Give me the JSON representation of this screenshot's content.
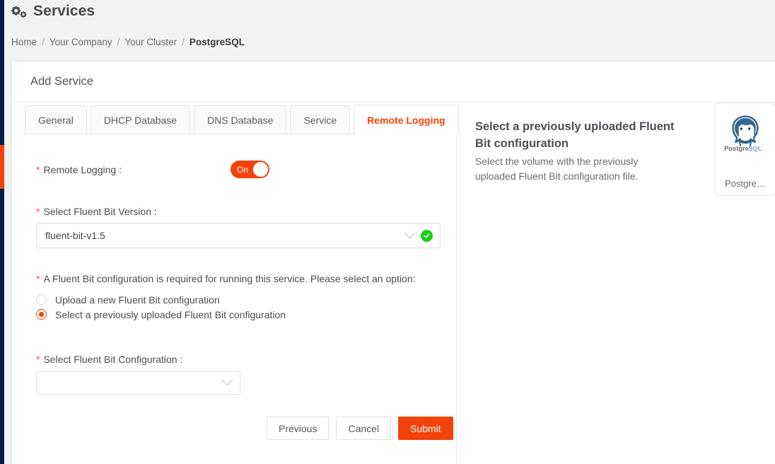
{
  "header": {
    "icon": "cogs-icon",
    "title": "Services",
    "breadcrumb": [
      {
        "label": "Home",
        "current": false
      },
      {
        "label": "Your Company",
        "current": false
      },
      {
        "label": "Your Cluster",
        "current": false
      },
      {
        "label": "PostgreSQL",
        "current": true
      }
    ],
    "separator": "/"
  },
  "card": {
    "title": "Add Service"
  },
  "tabs": [
    {
      "label": "General",
      "active": false
    },
    {
      "label": "DHCP Database",
      "active": false
    },
    {
      "label": "DNS Database",
      "active": false
    },
    {
      "label": "Service",
      "active": false
    },
    {
      "label": "Remote Logging",
      "active": true
    }
  ],
  "form": {
    "required_marker": "*",
    "remote_logging": {
      "label": "Remote Logging :",
      "toggle_state": "On"
    },
    "version": {
      "label": "Select Fluent Bit Version :",
      "value": "fluent-bit-v1.5",
      "placeholder": "",
      "validated": true,
      "valid_icon": "check-circle-icon",
      "chevron_icon": "chevron-down-icon"
    },
    "config_choice": {
      "label": "A Fluent Bit configuration is required for running this service. Please select an option:",
      "options": [
        {
          "label": "Upload a new Fluent Bit configuration",
          "selected": false
        },
        {
          "label": "Select a previously uploaded Fluent Bit configuration",
          "selected": true
        }
      ]
    },
    "config_select": {
      "label": "Select Fluent Bit Configuration :",
      "value": "",
      "placeholder": "",
      "chevron_icon": "chevron-down-icon"
    },
    "buttons": {
      "previous": "Previous",
      "cancel": "Cancel",
      "submit": "Submit"
    }
  },
  "help": {
    "title": "Select a previously uploaded Fluent Bit configuration",
    "description": "Select the volume with the previously uploaded Fluent Bit configuration file."
  },
  "service_card": {
    "logo": "postgresql-logo",
    "logo_text": "PostgreSQL",
    "name": "Postgre…"
  },
  "colors": {
    "accent": "#f4430a",
    "rail": "#001a4d",
    "success": "#18d017",
    "required": "#f5445c",
    "page_bg": "#f2f2f2",
    "postgres_blue": "#336791"
  }
}
